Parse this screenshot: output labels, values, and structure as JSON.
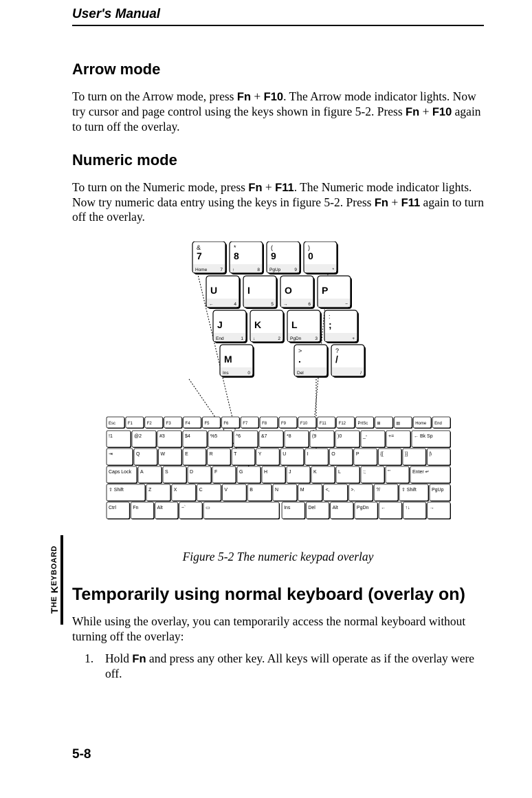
{
  "header": {
    "title": "User's Manual"
  },
  "sections": {
    "arrow": {
      "heading": "Arrow mode",
      "p_a": "To turn on the Arrow mode, press ",
      "key1": "Fn",
      "plus1": " + ",
      "key2": "F10",
      "p_b": ". The Arrow mode indicator lights. Now try cursor and page control using the keys shown in figure 5-2. Press ",
      "key3": "Fn",
      "plus2": " + ",
      "key4": "F10",
      "p_c": " again to turn off the overlay."
    },
    "numeric": {
      "heading": "Numeric mode",
      "p_a": "To turn on the Numeric mode, press ",
      "key1": "Fn",
      "plus1": " + ",
      "key2": "F11",
      "p_b": ".  The Numeric mode indicator lights. Now try numeric data entry using the keys in figure 5-2. Press ",
      "key3": "Fn",
      "plus2": " + ",
      "key4": "F11",
      "p_c": " again to turn off the overlay."
    },
    "figure": {
      "caption": "Figure 5-2 The numeric keypad overlay"
    },
    "temporary": {
      "heading": "Temporarily using normal keyboard (overlay on)",
      "p": "While using the overlay, you can temporarily access the normal keyboard without turning off the overlay:",
      "step1_num": "1.",
      "step1_a": "Hold ",
      "step1_key": "Fn",
      "step1_b": " and press any other key. All keys will operate as if the overlay were off."
    }
  },
  "overlayKeys": {
    "row1": [
      {
        "top": "&",
        "mid": "7",
        "bl": "Home",
        "br": "7"
      },
      {
        "top": "*",
        "mid": "8",
        "bl": "↑",
        "br": "8"
      },
      {
        "top": "(",
        "mid": "9",
        "bl": "PgUp",
        "br": "9"
      },
      {
        "top": ")",
        "mid": "0",
        "bl": "",
        "br": "*"
      }
    ],
    "row2": [
      {
        "mid": "U",
        "bl": "←",
        "br": "4"
      },
      {
        "mid": "I",
        "bl": "",
        "br": "5"
      },
      {
        "mid": "O",
        "bl": "→",
        "br": "6"
      },
      {
        "mid": "P",
        "bl": "",
        "br": "−"
      }
    ],
    "row3": [
      {
        "mid": "J",
        "bl": "End",
        "br": "1"
      },
      {
        "mid": "K",
        "bl": "↓",
        "br": "2"
      },
      {
        "mid": "L",
        "bl": "PgDn",
        "br": "3"
      },
      {
        "top": ":",
        "mid": ";",
        "bl": "",
        "br": "+"
      }
    ],
    "row4": [
      {
        "mid": "M",
        "bl": "Ins",
        "br": "0"
      },
      {
        "top": ">",
        "mid": ".",
        "bl": "Del",
        "br": ""
      },
      {
        "top": "?",
        "mid": "/",
        "bl": "",
        "br": "/"
      }
    ]
  },
  "mainKeyboard": {
    "row0": [
      "Esc",
      "F1",
      "F2",
      "F3",
      "F4",
      "F5",
      "F6",
      "F7",
      "F8",
      "F9",
      "F10",
      "F11",
      "F12",
      "PrtSc",
      "⊞",
      "▤",
      "Home",
      "End"
    ],
    "row1": [
      "!1",
      "@2",
      "#3",
      "$4",
      "%5",
      "^6",
      "&7",
      "*8",
      "(9",
      ")0",
      "_-",
      "+=",
      "← Bk Sp"
    ],
    "row2": [
      "⇥",
      "Q",
      "W",
      "E",
      "R",
      "T",
      "Y",
      "U",
      "I",
      "O",
      "P",
      "{[",
      "}]",
      "|\\"
    ],
    "row3": [
      "Caps Lock",
      "A",
      "S",
      "D",
      "F",
      "G",
      "H",
      "J",
      "K",
      "L",
      ":;",
      "\"'",
      "Enter ↵"
    ],
    "row4": [
      "⇧ Shift",
      "Z",
      "X",
      "C",
      "V",
      "B",
      "N",
      "M",
      "<,",
      ">.",
      "?/",
      "⇧ Shift",
      "PgUp"
    ],
    "row5": [
      "Ctrl",
      "Fn",
      "Alt",
      "~`",
      "▭",
      "",
      "Ins",
      "Del",
      "Alt",
      "PgDn",
      "←",
      "↑↓",
      "→"
    ]
  },
  "sidebar": {
    "label": "THE KEYBOARD"
  },
  "pageNumber": "5-8"
}
